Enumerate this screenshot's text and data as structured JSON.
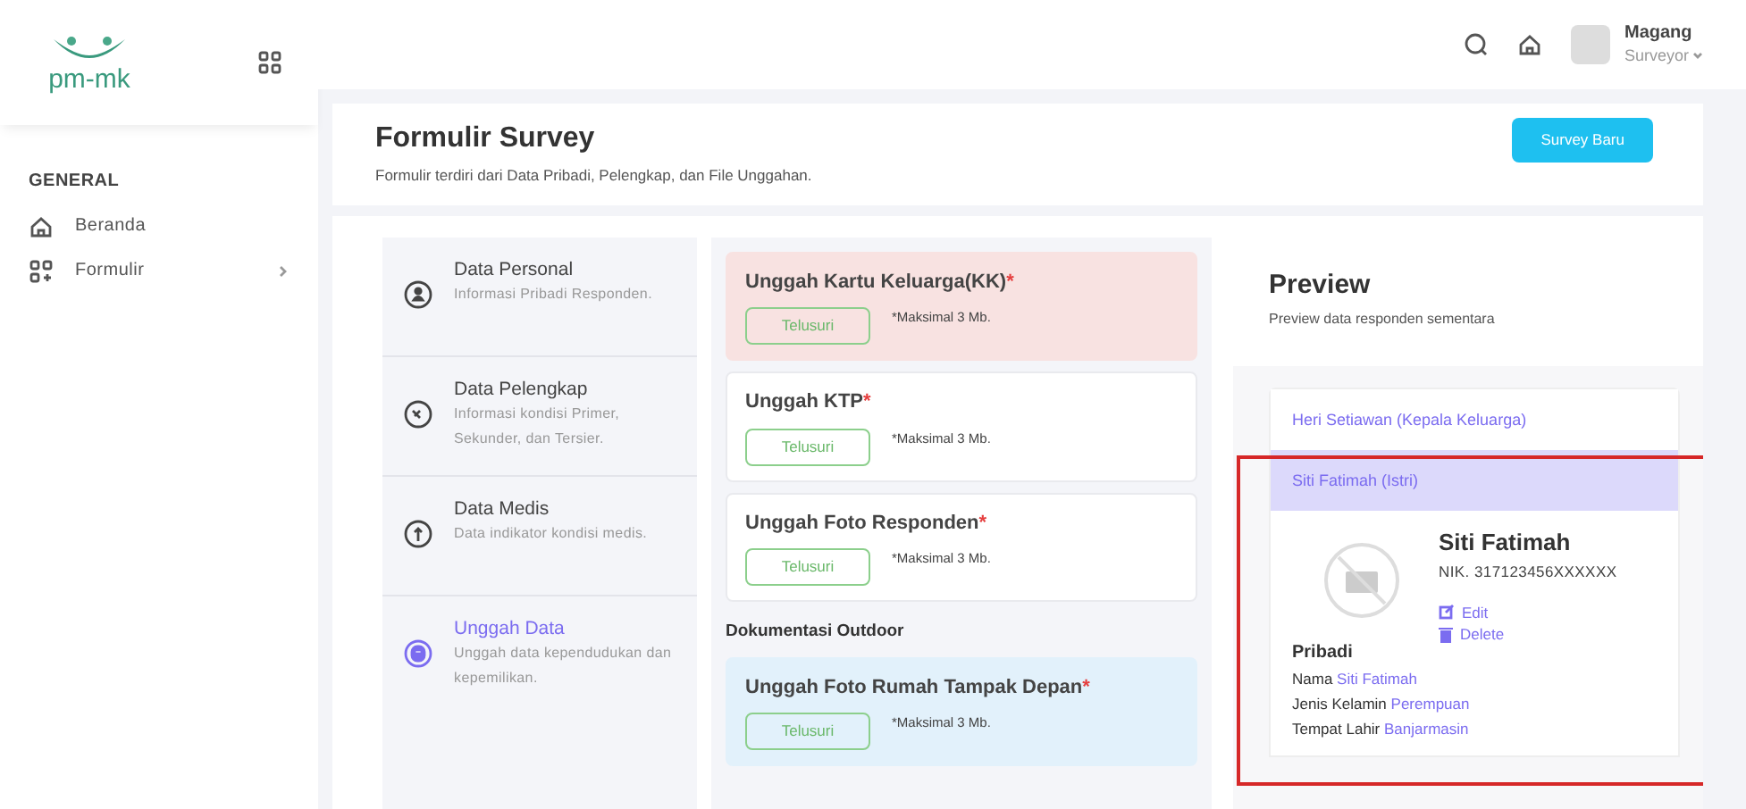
{
  "sidebar": {
    "logo_text": "pm-mk",
    "section": "GENERAL",
    "items": [
      {
        "label": "Beranda",
        "has_submenu": false
      },
      {
        "label": "Formulir",
        "has_submenu": true
      }
    ]
  },
  "header": {
    "user_name": "Magang",
    "user_role": "Surveyor"
  },
  "page": {
    "title": "Formulir Survey",
    "subtitle": "Formulir terdiri dari Data Pribadi, Pelengkap, dan File Unggahan.",
    "action": "Survey Baru"
  },
  "steps": [
    {
      "title": "Data Personal",
      "desc": "Informasi Pribadi Responden.",
      "selected": false
    },
    {
      "title": "Data Pelengkap",
      "desc": "Informasi kondisi Primer, Sekunder, dan Tersier.",
      "selected": false
    },
    {
      "title": "Data Medis",
      "desc": "Data indikator kondisi medis.",
      "selected": false
    },
    {
      "title": "Unggah Data",
      "desc": "Unggah data kependudukan dan kepemilikan.",
      "selected": true
    }
  ],
  "uploads": [
    {
      "kind": "error",
      "title": "Unggah Kartu Keluarga(KK)",
      "mark": "*",
      "button": "Telusuri",
      "note": "*Maksimal 3 Mb."
    },
    {
      "kind": "plain",
      "title": "Unggah KTP",
      "mark": "*",
      "button": "Telusuri",
      "note": "*Maksimal 3 Mb."
    },
    {
      "kind": "plain",
      "title": "Unggah Foto Responden",
      "mark": "*",
      "button": "Telusuri",
      "note": "*Maksimal 3 Mb."
    },
    {
      "kind": "heading",
      "title": "Dokumentasi Outdoor"
    },
    {
      "kind": "info",
      "title": "Unggah Foto Rumah Tampak Depan",
      "mark": "*",
      "button": "Telusuri",
      "note": "*Maksimal 3 Mb."
    }
  ],
  "preview": {
    "title": "Preview",
    "subtitle": "Preview data responden sementara",
    "highlight_frame": true,
    "members": [
      {
        "label": "Heri Setiawan (Kepala Keluarga)",
        "selected": false
      },
      {
        "label": "Siti Fatimah (Istri)",
        "selected": true
      }
    ],
    "detail": {
      "name": "Siti Fatimah",
      "nik": "NIK. 317123456XXXXXX",
      "edit": "Edit",
      "delete": "Delete",
      "section": "Pribadi",
      "fields": [
        {
          "label": "Nama",
          "value": "Siti Fatimah"
        },
        {
          "label": "Jenis Kelamin",
          "value": "Perempuan"
        },
        {
          "label": "Tempat Lahir",
          "value": "Banjarmasin"
        }
      ]
    }
  }
}
